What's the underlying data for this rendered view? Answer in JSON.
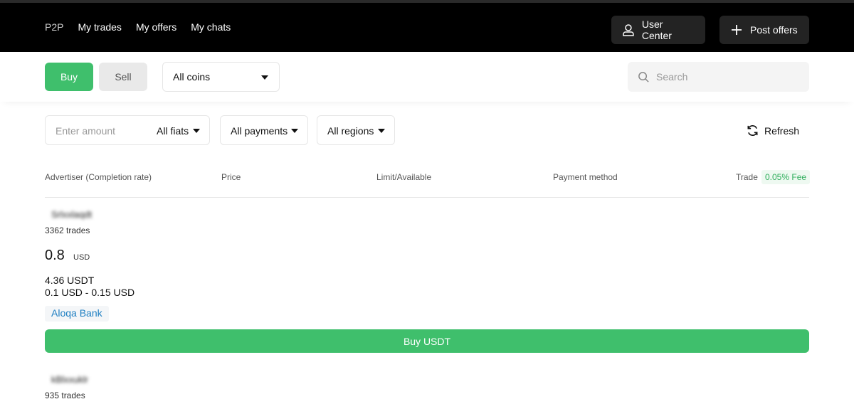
{
  "nav": {
    "items": [
      "P2P",
      "My trades",
      "My offers",
      "My chats"
    ],
    "user_center": "User Center",
    "post_offers": "Post offers"
  },
  "filters": {
    "buy": "Buy",
    "sell": "Sell",
    "coin": "All coins",
    "search_placeholder": "Search",
    "amount_placeholder": "Enter amount",
    "fiats": "All fiats",
    "payments": "All payments",
    "regions": "All regions",
    "refresh": "Refresh"
  },
  "table": {
    "headers": [
      "Advertiser (Completion rate)",
      "Price",
      "Limit/Available",
      "Payment method",
      "Trade"
    ],
    "fee": "0.05% Fee"
  },
  "offers": [
    {
      "name": "Srlxxlaqdt",
      "trades": "3362 trades",
      "price": "0.8",
      "currency": "USD",
      "available": "4.36 USDT",
      "limit": "0.1 USD - 0.15 USD",
      "payment": "Aloqa Bank",
      "action": "Buy USDT"
    },
    {
      "name": "kBlxxuklr",
      "trades": "935 trades"
    }
  ],
  "colors": {
    "accent": "#3fbf6c",
    "topbar": "#000000",
    "payment_text": "#1e7fc2"
  }
}
